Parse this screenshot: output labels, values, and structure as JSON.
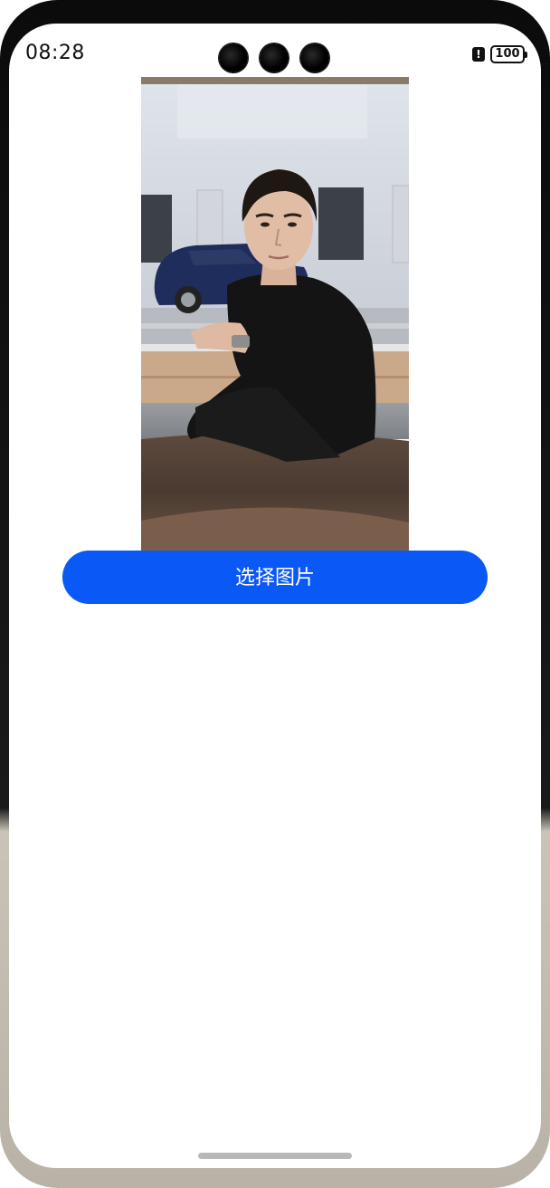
{
  "status_bar": {
    "time": "08:28",
    "alert_icon": "alert-icon",
    "battery_level": "100"
  },
  "photo": {
    "icon": "photo-of-man-at-table"
  },
  "actions": {
    "select_image_label": "选择图片"
  },
  "colors": {
    "accent": "#0a59f7"
  }
}
